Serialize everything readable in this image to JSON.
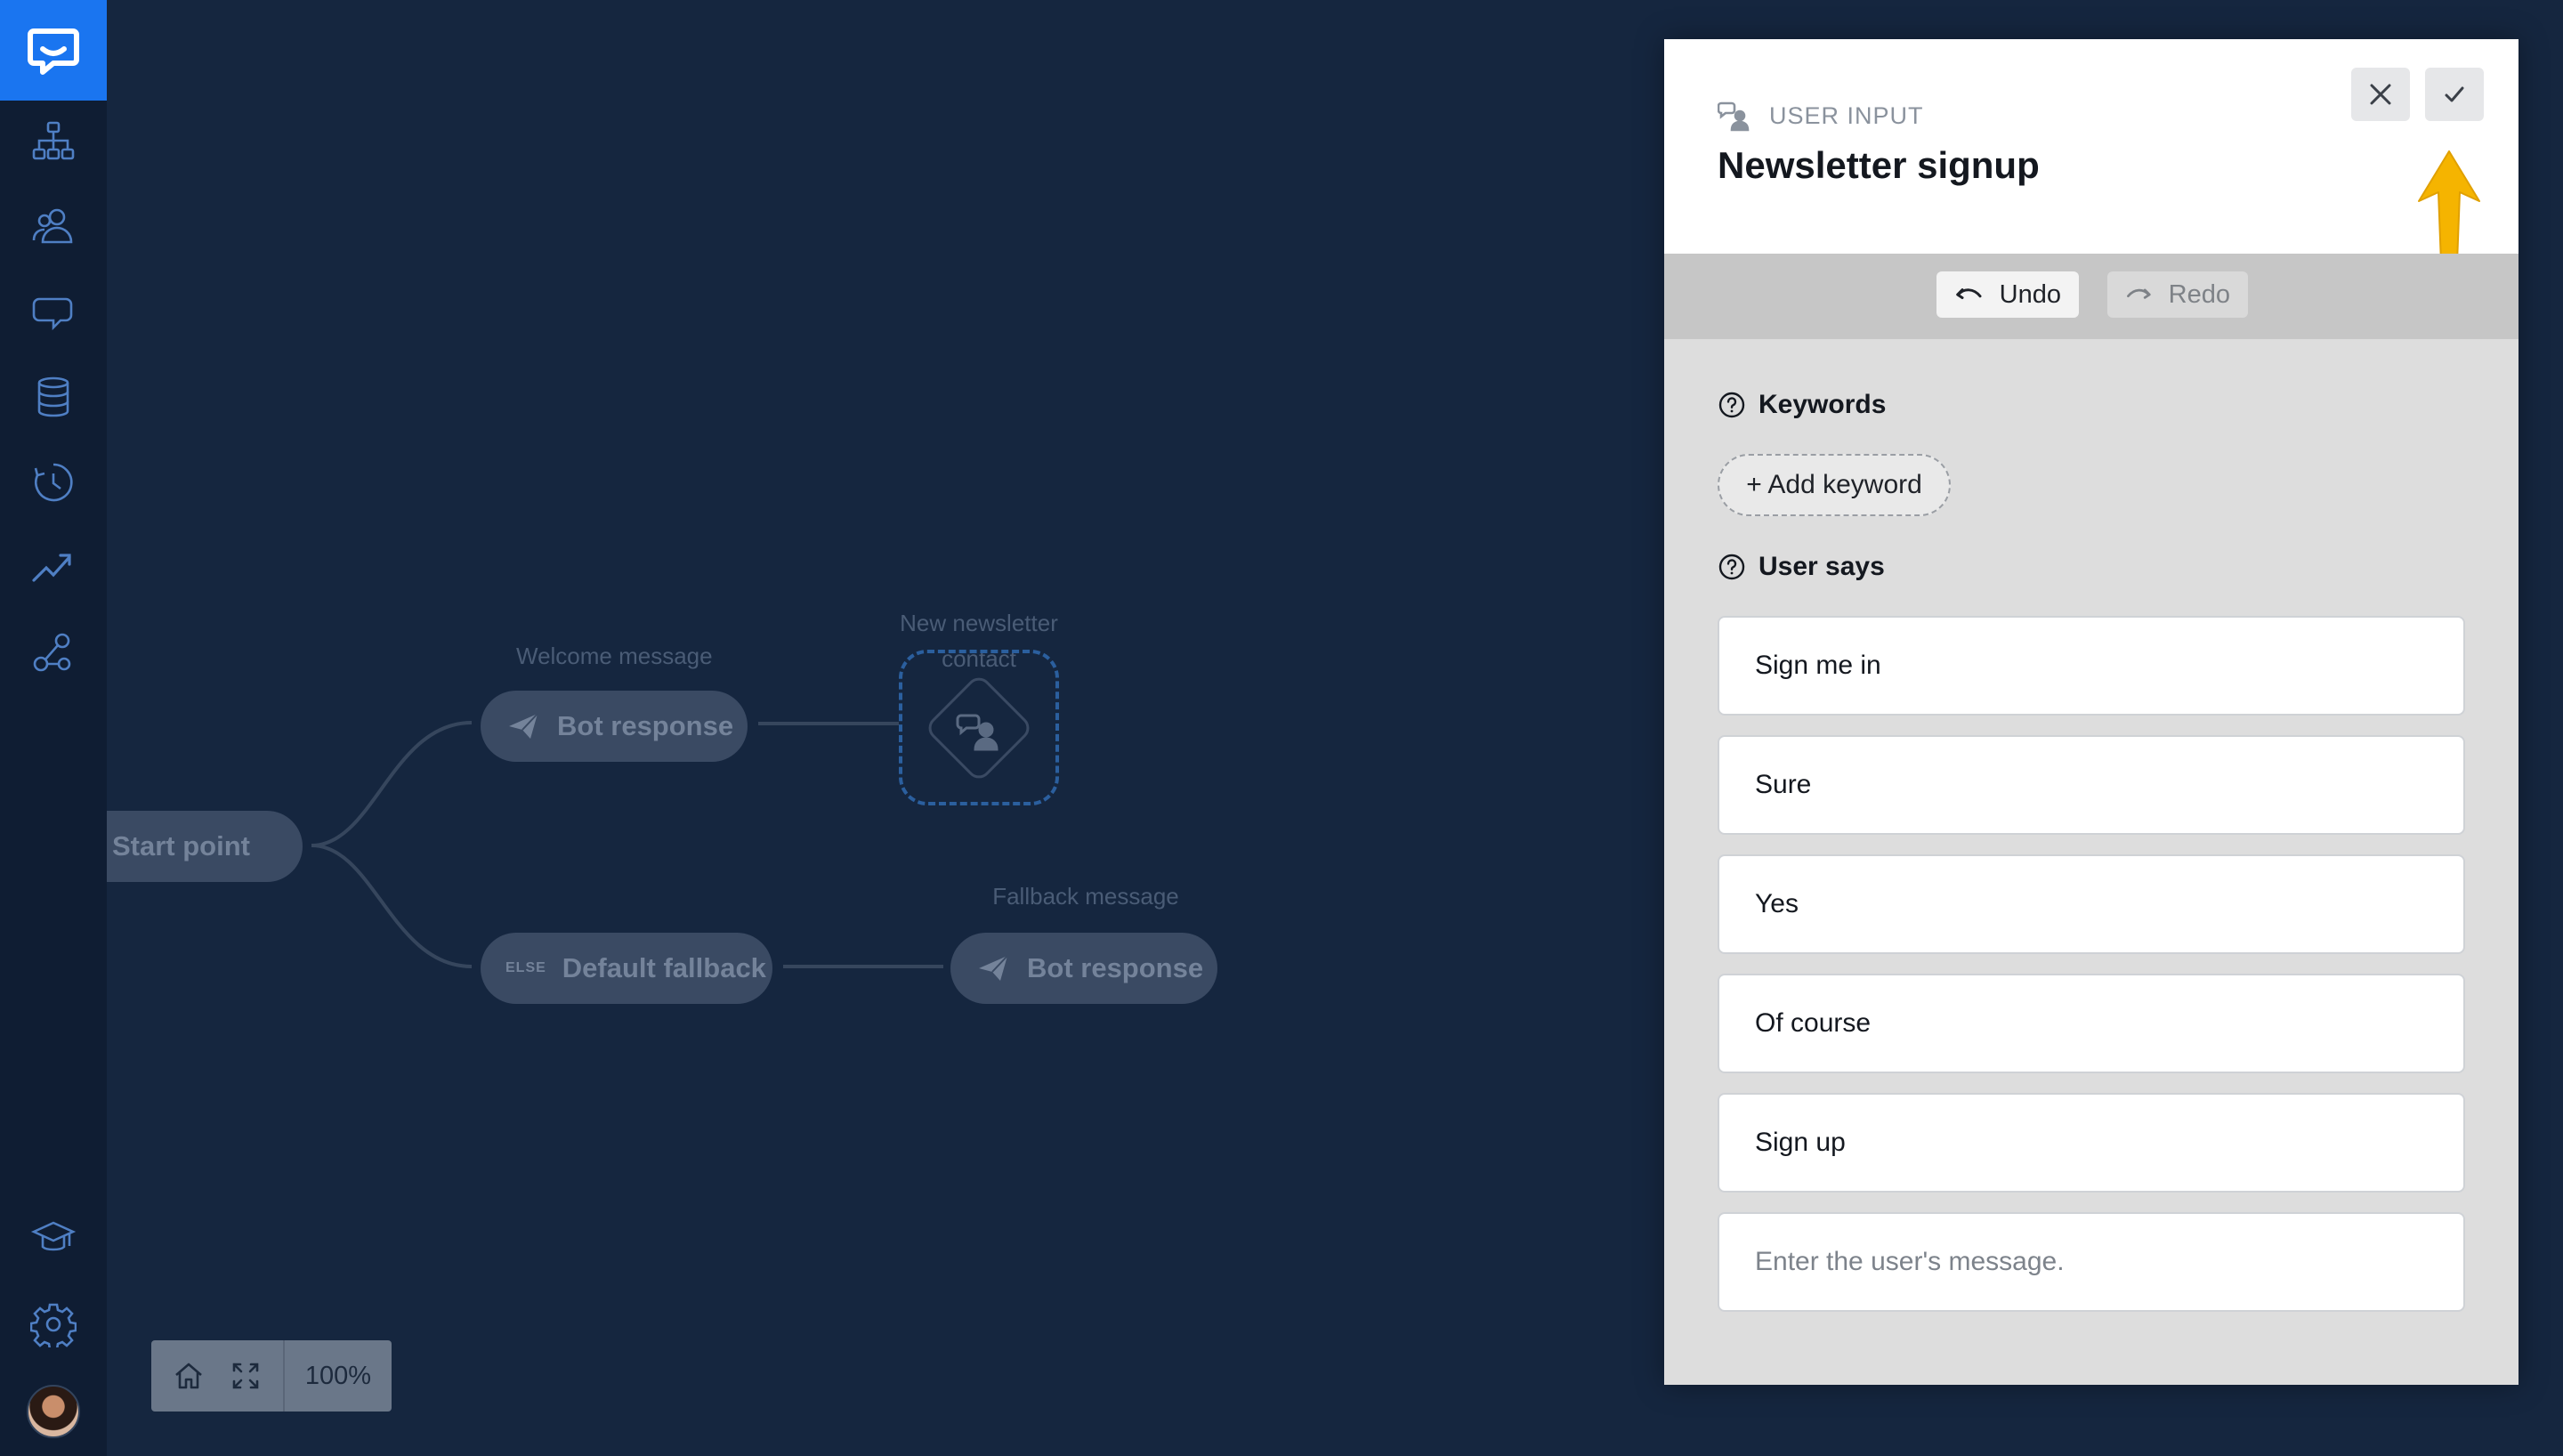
{
  "sidebar": {
    "logo_icon": "chat-bubble-logo-icon",
    "items": [
      {
        "name": "sidebar-item-stories",
        "icon": "flow-tree-icon"
      },
      {
        "name": "sidebar-item-audience",
        "icon": "users-icon"
      },
      {
        "name": "sidebar-item-chats",
        "icon": "chat-bubbles-icon"
      },
      {
        "name": "sidebar-item-data",
        "icon": "database-icon"
      },
      {
        "name": "sidebar-item-history",
        "icon": "history-clock-icon"
      },
      {
        "name": "sidebar-item-reports",
        "icon": "trending-up-icon"
      },
      {
        "name": "sidebar-item-integrations",
        "icon": "integrations-icon"
      },
      {
        "name": "sidebar-item-academy",
        "icon": "graduation-cap-icon"
      },
      {
        "name": "sidebar-item-settings",
        "icon": "gear-icon"
      }
    ],
    "accent": "#1a75f0"
  },
  "flow": {
    "start": "Start point",
    "welcome_label": "Welcome message",
    "welcome_node": "Bot response",
    "newsletter_label": "New newsletter contact",
    "fallback_node": "Default fallback",
    "else_tag": "ELSE",
    "fallback_label": "Fallback message",
    "fallback_response": "Bot response"
  },
  "zoom": {
    "value": "100%"
  },
  "panel": {
    "type_label": "USER INPUT",
    "title": "Newsletter signup",
    "undo": "Undo",
    "redo": "Redo",
    "keywords_heading": "Keywords",
    "add_keyword": "+ Add keyword",
    "user_says_heading": "User says",
    "phrases": [
      "Sign me in",
      "Sure",
      "Yes",
      "Of course",
      "Sign up"
    ],
    "input_placeholder": "Enter the user's message.",
    "highlight_color": "#f5b400"
  }
}
